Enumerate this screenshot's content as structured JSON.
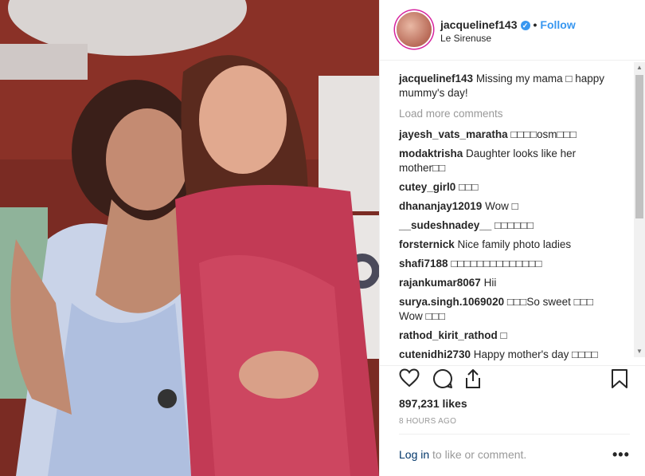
{
  "post": {
    "image_alt": "Photo",
    "header": {
      "username": "jacquelinef143",
      "verified_icon": "verified-badge-icon",
      "separator": "•",
      "follow_label": "Follow",
      "location": "Le Sirenuse"
    },
    "caption": {
      "username": "jacquelinef143",
      "text": "Missing my mama □ happy mummy's day!"
    },
    "load_more_label": "Load more comments",
    "comments": [
      {
        "user": "jayesh_vats_maratha",
        "text": "□□□□osm□□□"
      },
      {
        "user": "modaktrisha",
        "text": "Daughter looks like her mother□□"
      },
      {
        "user": "cutey_girl0",
        "text": "□□□"
      },
      {
        "user": "dhananjay12019",
        "text": "Wow □"
      },
      {
        "user": "__sudeshnadey__",
        "text": "□□□□□□"
      },
      {
        "user": "forsternick",
        "text": "Nice family photo ladies"
      },
      {
        "user": "shafi7188",
        "text": "□□□□□□□□□□□□□□"
      },
      {
        "user": "rajankumar8067",
        "text": "Hii"
      },
      {
        "user": "surya.singh.1069020",
        "text": "□□□So sweet □□□ Wow □□□"
      },
      {
        "user": "rathod_kirit_rathod",
        "text": "□"
      },
      {
        "user": "cutenidhi2730",
        "text": "Happy mother's day □□□□"
      }
    ],
    "likes": "897,231 likes",
    "time": "8 HOURS AGO",
    "login": {
      "link": "Log in",
      "rest": "to like or comment."
    },
    "more_label": "•••",
    "colors": {
      "accent": "#3897f0",
      "text": "#262626",
      "muted": "#999999",
      "login_link": "#003569"
    }
  }
}
